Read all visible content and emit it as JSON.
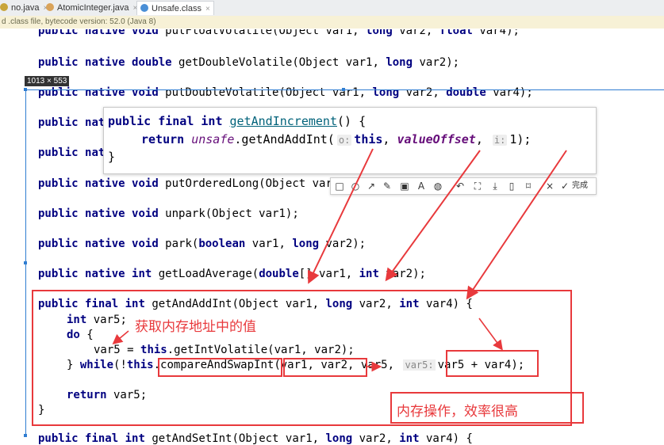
{
  "tabs": [
    {
      "label": "no.java",
      "icon_color": "#c9a53a",
      "active": false
    },
    {
      "label": "AtomicInteger.java",
      "icon_color": "#d9a35a",
      "active": false
    },
    {
      "label": "Unsafe.class",
      "icon_color": "#4a8fd6",
      "active": true
    }
  ],
  "close_glyph": "×",
  "infobar": {
    "text": "d .class file, bytecode version: 52.0 (Java 8)"
  },
  "size_badge": "1013 × 553",
  "code_lines": [
    "public native void putFloatVolatile(Object var1, long var2, float var4);",
    "public native double getDoubleVolatile(Object var1, long var2);",
    "public native void putDoubleVolatile(Object var1, long var2, double var4);",
    "public native",
    "public native",
    "public native void putOrderedLong(Object var1, long var2, long var4);",
    "public native void unpark(Object var1);",
    "public native void park(boolean var1, long var2);",
    "public native int getLoadAverage(double[] var1, int var2);"
  ],
  "method": {
    "signature": "public final int getAndAddInt(Object var1, long var2, int var4) {",
    "decl": "int var5;",
    "do": "do {",
    "assign": "var5 = this.getIntVolatile(var1, var2);",
    "while_pre": "} while(!this",
    "cas": ".compareAndSwapInt",
    "args": "(var1, var2",
    "args_mid": ", var5, ",
    "hint": "var5:",
    "expr": "var5 + var4",
    "end": ");",
    "ret": "return var5;",
    "close": "}",
    "next_line": "public final int getAndSetInt(Object var1, long var2, int var4) {"
  },
  "popup": {
    "line1_kw": "public final int ",
    "line1_meth": "getAndIncrement",
    "line1_rest": "() {",
    "line2_ret": "return ",
    "line2_unsafe": "unsafe",
    "line2_call": ".getAndAddInt(",
    "hint_o": "o:",
    "this_kw": "this",
    "comma1": ", ",
    "field": "valueOffset",
    "comma2": ", ",
    "hint_i": "i:",
    "num": "1);",
    "line3": "}"
  },
  "toolbar_icons": [
    "□",
    "○",
    "↗",
    "✎",
    "▣",
    "A",
    "◍",
    "↶",
    "⛶",
    "⤓",
    "▯",
    "⌑",
    "×",
    "✓"
  ],
  "toolbar_done": "完成",
  "annotations": {
    "get_value": "获取内存地址中的值",
    "memory_op": "内存操作，效率很高"
  },
  "accent_red": "#e8393c"
}
